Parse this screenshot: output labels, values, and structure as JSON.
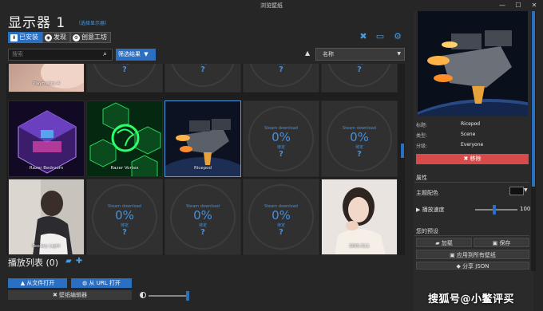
{
  "window": {
    "title": "浏览壁纸",
    "min_glyph": "—",
    "max_glyph": "☐",
    "close_glyph": "✕"
  },
  "header": {
    "title": "显示器 1",
    "select_monitor": "（选择显示器）"
  },
  "tabs": [
    {
      "label": "已安装",
      "icon": "download-icon",
      "active": true
    },
    {
      "label": "发现",
      "icon": "compass-icon",
      "active": false
    },
    {
      "label": "创意工坊",
      "icon": "steam-icon",
      "active": false
    }
  ],
  "toolbar_icons": [
    "tools-icon",
    "monitor-icon",
    "gear-icon"
  ],
  "search": {
    "placeholder": "搜索",
    "filter_label": "筛选结果"
  },
  "sort": {
    "value": "名称"
  },
  "grid": {
    "placeholder": {
      "status": "Steam download",
      "percent": "0%",
      "sub": "待定",
      "q": "?"
    },
    "partial_top_label": "Playmates 4",
    "tiles": [
      {
        "type": "image",
        "label": "Razer Bedroom"
      },
      {
        "type": "image",
        "label": "Razer Vortex"
      },
      {
        "type": "image",
        "label": "Ricepod",
        "selected": true
      },
      {
        "type": "placeholder"
      },
      {
        "type": "placeholder"
      },
      {
        "type": "image",
        "label": "Rockey Light"
      },
      {
        "type": "placeholder"
      },
      {
        "type": "placeholder"
      },
      {
        "type": "placeholder"
      },
      {
        "type": "image",
        "label": "SNIS-511"
      }
    ]
  },
  "playlist": {
    "label": "播放列表 (0)"
  },
  "buttons": {
    "open_file": "从文件打开",
    "open_url": "从 URL 打开",
    "editor": "壁纸编辑器"
  },
  "details": {
    "title_key": "标题:",
    "title_val": "Ricepod",
    "type_key": "类型:",
    "type_val": "Scene",
    "rating_key": "分级:",
    "rating_val": "Everyone",
    "remove": "移除"
  },
  "properties": {
    "header": "属性",
    "theme_color": "主题配色",
    "playback_rate": "播放速度",
    "rate_value": "100",
    "rate_fraction": 1.0,
    "theme_color_hex": "#111111"
  },
  "presets": {
    "header": "您的预设",
    "load": "加载",
    "save": "保存",
    "apply_all": "应用到所有壁纸",
    "share": "分享 JSON"
  },
  "watermark": "搜狐号@小鳖评买"
}
